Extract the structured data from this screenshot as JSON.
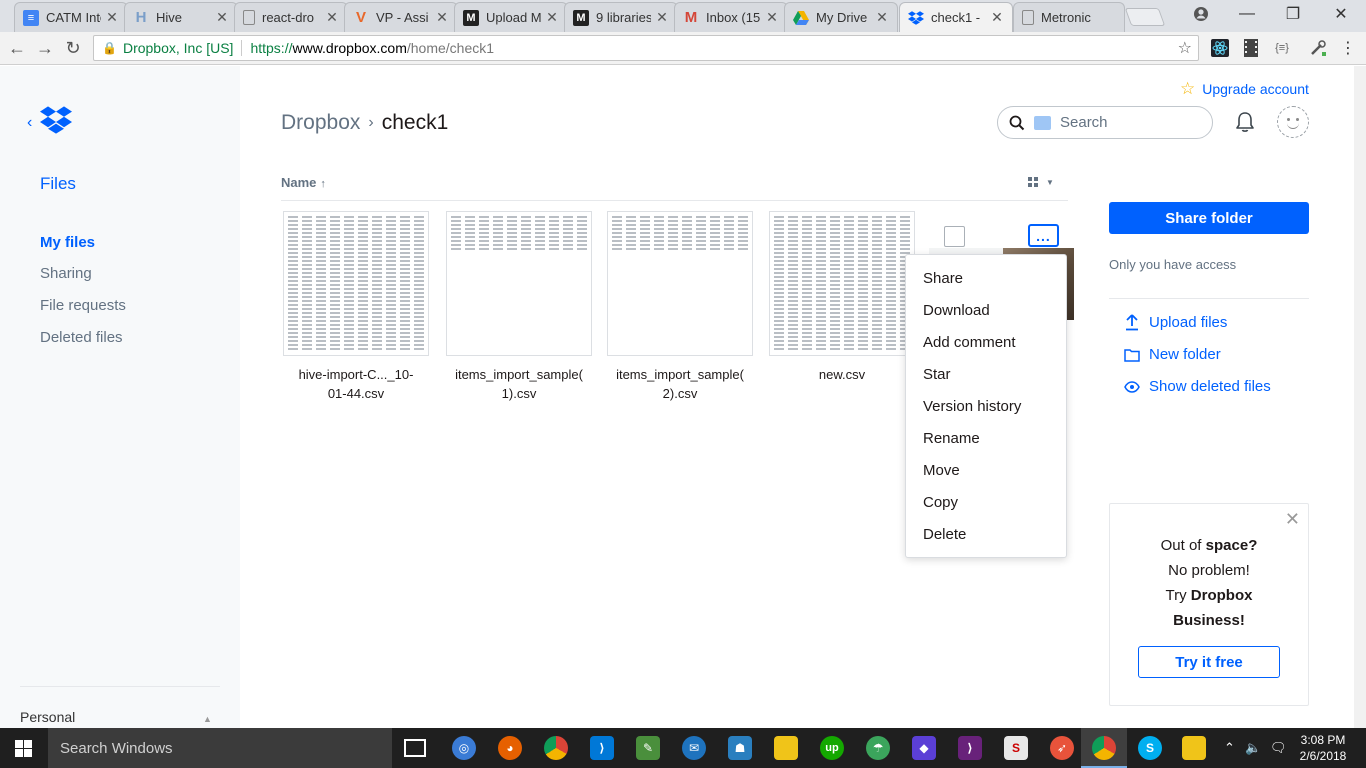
{
  "browser": {
    "tabs": [
      {
        "label": "CATM Inte",
        "icon": "docs-icon",
        "color": "#4285f4"
      },
      {
        "label": "Hive",
        "icon": "hive-icon",
        "color": "#7a9ec9"
      },
      {
        "label": "react-dro",
        "icon": "page-icon",
        "color": "#777777"
      },
      {
        "label": "VP - Assi",
        "icon": "vp-icon",
        "color": "#e8682b"
      },
      {
        "label": "Upload M",
        "icon": "medium-icon",
        "color": "#222222"
      },
      {
        "label": "9 libraries",
        "icon": "medium-icon",
        "color": "#222222"
      },
      {
        "label": "Inbox (15",
        "icon": "gmail-icon",
        "color": "#d44638"
      },
      {
        "label": "My Drive",
        "icon": "drive-icon",
        "color": "#f4b400"
      },
      {
        "label": "check1 - ",
        "icon": "dropbox-icon",
        "color": "#0061fe"
      },
      {
        "label": "Metronic",
        "icon": "page-icon",
        "color": "#777777"
      }
    ],
    "security_label": "Dropbox, Inc [US]",
    "url_scheme": "https://",
    "url_host": "www.dropbox.com",
    "url_path": "/home/check1"
  },
  "sidebar": {
    "files_heading": "Files",
    "items": [
      {
        "label": "My files",
        "active": true
      },
      {
        "label": "Sharing",
        "active": false
      },
      {
        "label": "File requests",
        "active": false
      },
      {
        "label": "Deleted files",
        "active": false
      }
    ],
    "account_label": "Personal"
  },
  "header": {
    "upgrade_label": "Upgrade account",
    "breadcrumb_root": "Dropbox",
    "breadcrumb_current": "check1",
    "search_placeholder": "Search"
  },
  "list": {
    "column_name": "Name",
    "sort_indicator": "↑",
    "files": [
      {
        "line1": "hive-import-C..._10-",
        "line2": "01-44.csv"
      },
      {
        "line1": "items_import_sample(",
        "line2": "1).csv"
      },
      {
        "line1": "items_import_sample(",
        "line2": "2).csv"
      },
      {
        "line1": "new.csv",
        "line2": ""
      }
    ],
    "more_button_label": "..."
  },
  "context_menu": {
    "items": [
      "Share",
      "Download",
      "Add comment",
      "Star",
      "Version history",
      "Rename",
      "Move",
      "Copy",
      "Delete"
    ]
  },
  "right_panel": {
    "share_folder_label": "Share folder",
    "access_text": "Only you have access",
    "actions": [
      "Upload files",
      "New folder",
      "Show deleted files"
    ]
  },
  "promo": {
    "line1_pre": "Out of ",
    "line1_bold": "space?",
    "line2": "No problem!",
    "line3_pre": "Try ",
    "line3_bold": "Dropbox",
    "line4_bold": "Business!",
    "button_label": "Try it free"
  },
  "taskbar": {
    "search_placeholder": "Search Windows",
    "time": "3:08 PM",
    "date": "2/6/2018"
  },
  "colors": {
    "accent": "#0061fe",
    "muted_text": "#637282",
    "star": "#f5b400"
  }
}
